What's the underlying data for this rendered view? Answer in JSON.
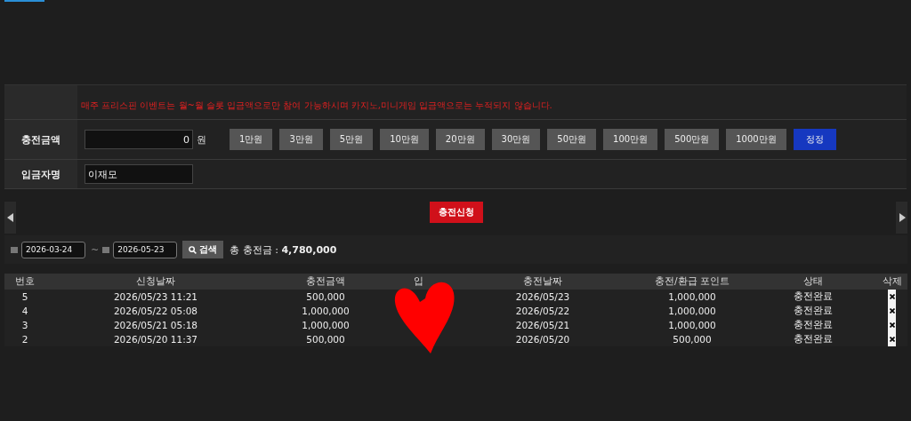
{
  "notice": "매주 프리스핀 이벤트는 월~월 슬롯 입금액으로만 참여 가능하시며 카지노,미니게임 입금액으로는 누적되지 않습니다.",
  "amount_row": {
    "label": "충전금액",
    "value": "0",
    "unit": "원",
    "presets": [
      "1만원",
      "3만원",
      "5만원",
      "10만원",
      "20만원",
      "30만원",
      "50만원",
      "100만원",
      "500만원",
      "1000만원"
    ],
    "reset_button": "정정"
  },
  "depositor_row": {
    "label": "입금자명",
    "value": "이재모"
  },
  "submit_button": "충전신청",
  "search": {
    "from": "2026-03-24",
    "separator": "~",
    "to": "2026-05-23",
    "button": "검색",
    "total": "총 충전금 : **4,780,000**"
  },
  "table": {
    "columns": [
      "번호",
      "신청날짜",
      "충전금액",
      "입",
      "충전날짜",
      "충전/환급 포인트",
      "상태",
      "삭제"
    ],
    "rows": [
      {
        "no": "5",
        "requested": "2026/05/23 11:21",
        "amount": "500,000",
        "charged": "2026/05/23",
        "points": "1,000,000",
        "status": "충전완료"
      },
      {
        "no": "4",
        "requested": "2026/05/22 05:08",
        "amount": "1,000,000",
        "charged": "2026/05/22",
        "points": "1,000,000",
        "status": "충전완료"
      },
      {
        "no": "3",
        "requested": "2026/05/21 05:18",
        "amount": "1,000,000",
        "charged": "2026/05/21",
        "points": "1,000,000",
        "status": "충전완료"
      },
      {
        "no": "2",
        "requested": "2026/05/20 11:37",
        "amount": "500,000",
        "charged": "2026/05/20",
        "points": "500,000",
        "status": "충전완료"
      }
    ]
  }
}
